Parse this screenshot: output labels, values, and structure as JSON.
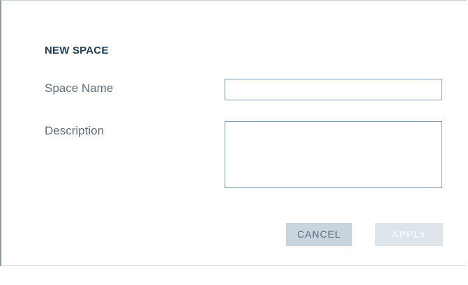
{
  "dialog": {
    "title": "NEW SPACE",
    "fields": {
      "name_label": "Space Name",
      "name_value": "",
      "description_label": "Description",
      "description_value": ""
    },
    "buttons": {
      "cancel_label": "CANCEL",
      "apply_label": "APPLY"
    }
  }
}
